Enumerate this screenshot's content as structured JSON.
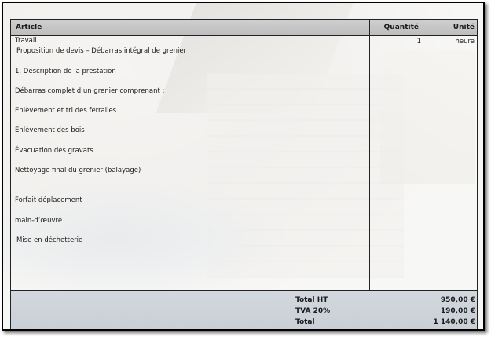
{
  "table": {
    "headers": {
      "article": "Article",
      "quantity": "Quantité",
      "unit": "Unité"
    },
    "row": {
      "title": "Travail",
      "subtitle": "Proposition de devis – Débarras intégral de grenier",
      "quantity": "1",
      "unit": "heure",
      "description_lines": [
        "1. Description de la prestation",
        "Débarras complet d’un grenier comprenant :",
        "Enlèvement et tri des ferralles",
        "Enlèvement des bois",
        "Évacuation des gravats",
        "Nettoyage final du grenier (balayage)",
        "Forfait déplacement",
        "main-d’œuvre",
        "Mise en déchetterie"
      ]
    }
  },
  "totals": [
    {
      "label": "Total HT",
      "value": "950,00 €"
    },
    {
      "label": "TVA 20%",
      "value": "190,00 €"
    },
    {
      "label": "Total",
      "value": "1 140,00 €"
    }
  ]
}
